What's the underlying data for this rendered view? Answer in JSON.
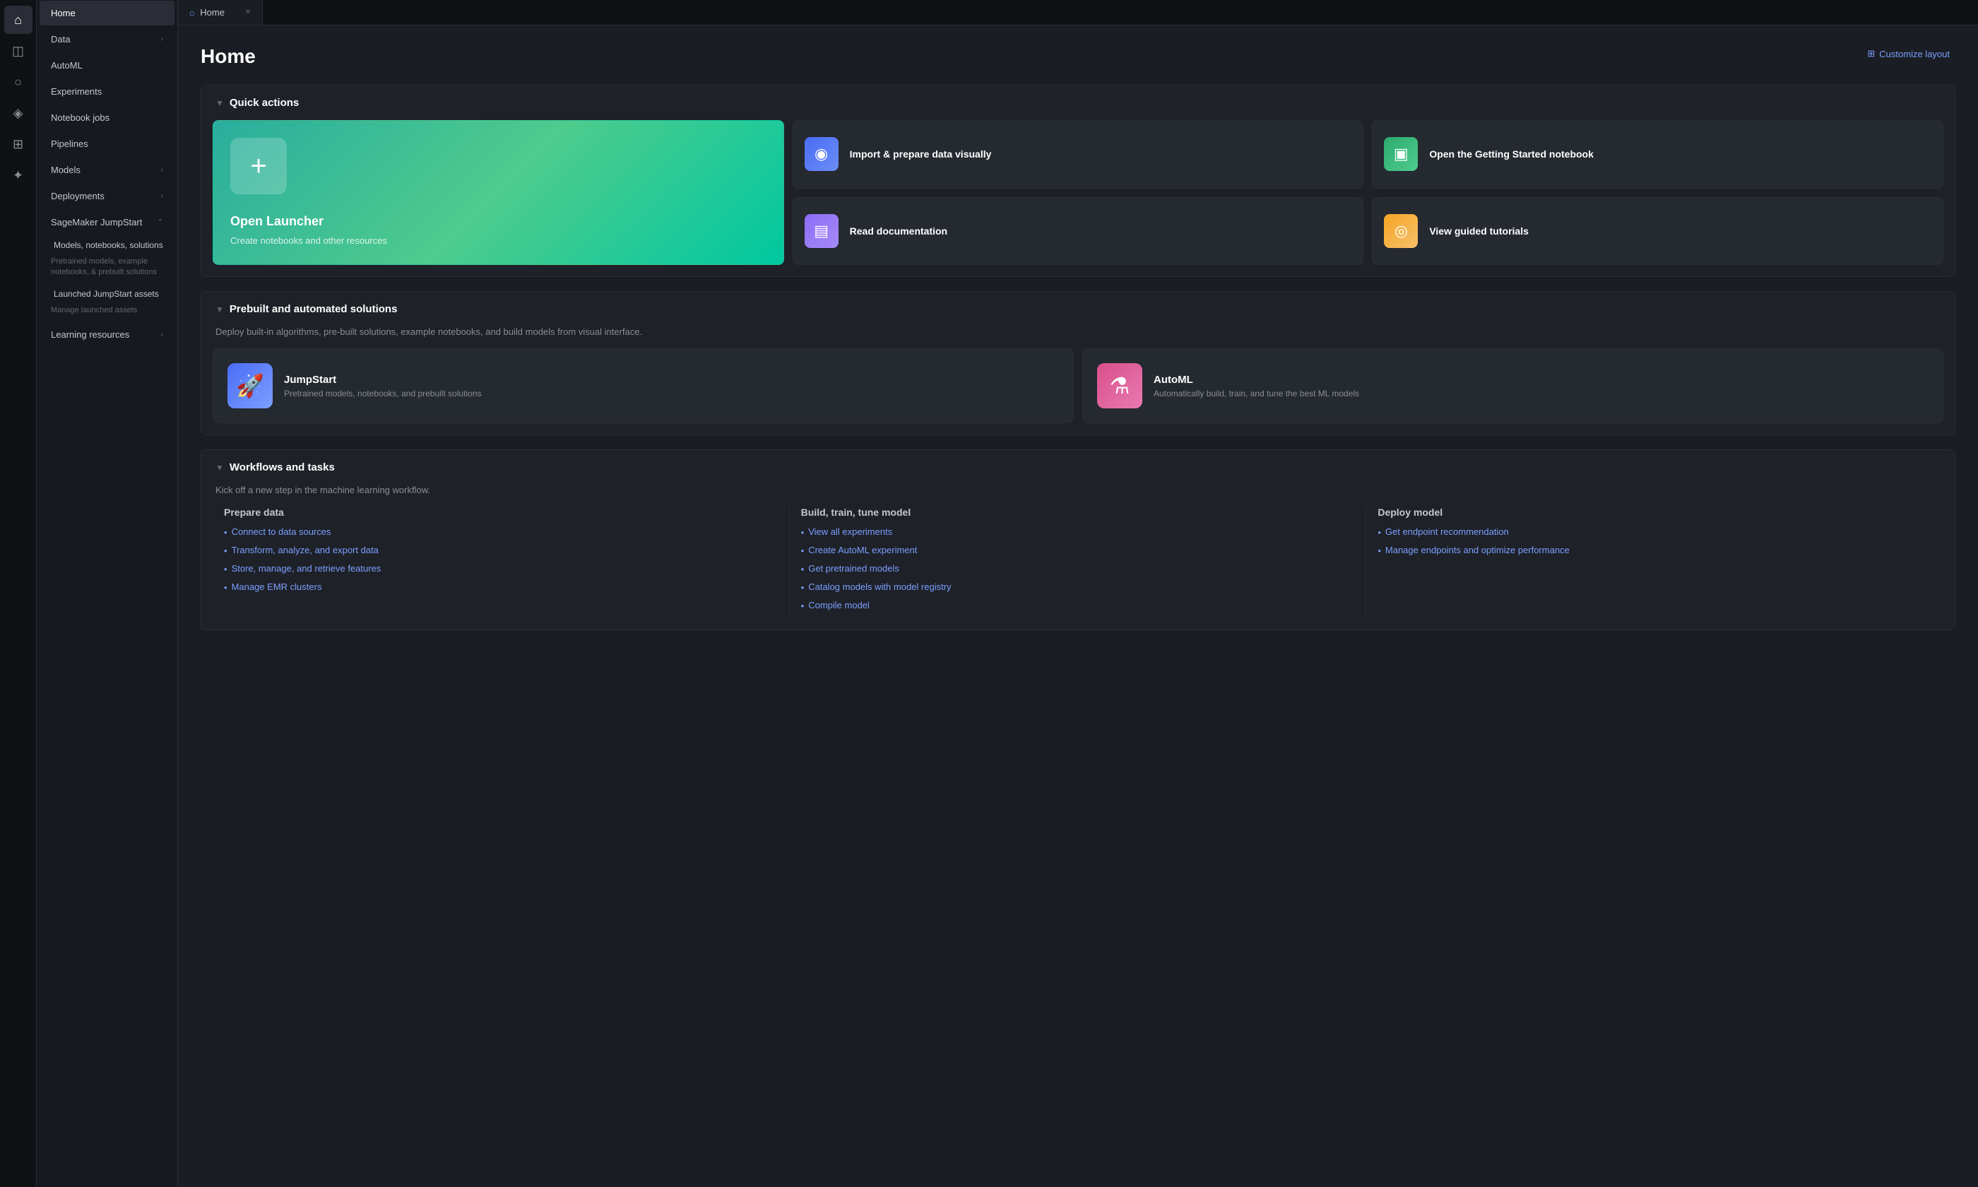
{
  "iconSidebar": {
    "items": [
      {
        "id": "home",
        "icon": "⌂",
        "active": true
      },
      {
        "id": "data",
        "icon": "◫"
      },
      {
        "id": "automl",
        "icon": "○"
      },
      {
        "id": "experiments",
        "icon": "◈"
      },
      {
        "id": "pipelines",
        "icon": "⊞"
      },
      {
        "id": "plugin",
        "icon": "✦"
      }
    ]
  },
  "navSidebar": {
    "items": [
      {
        "label": "Home",
        "active": true
      },
      {
        "label": "Data",
        "hasChevron": true
      },
      {
        "label": "AutoML"
      },
      {
        "label": "Experiments"
      },
      {
        "label": "Notebook jobs"
      },
      {
        "label": "Pipelines"
      },
      {
        "label": "Models",
        "hasChevron": true
      },
      {
        "label": "Deployments",
        "hasChevron": true
      },
      {
        "label": "SageMaker JumpStart",
        "hasChevron": true,
        "expanded": true,
        "subItems": [
          {
            "label": "Models, notebooks, solutions",
            "description": "Pretrained models, example notebooks, & prebuilt solutions"
          },
          {
            "label": "Launched JumpStart assets",
            "description": "Manage launched assets"
          }
        ]
      },
      {
        "label": "Learning resources",
        "hasChevron": true
      }
    ]
  },
  "tab": {
    "icon": "⌂",
    "label": "Home",
    "closeLabel": "✕"
  },
  "page": {
    "title": "Home",
    "customizeLayoutLabel": "Customize layout",
    "customizeLayoutIcon": "⊞"
  },
  "quickActions": {
    "sectionTitle": "Quick actions",
    "chevron": "▼",
    "openLauncher": {
      "label": "Open Launcher",
      "description": "Create notebooks and other resources",
      "icon": "+"
    },
    "cards": [
      {
        "label": "Import & prepare data visually",
        "icon": "◉",
        "color": "blue"
      },
      {
        "label": "Open the Getting Started notebook",
        "icon": "▣",
        "color": "green"
      },
      {
        "label": "Read documentation",
        "icon": "▤",
        "color": "purple"
      },
      {
        "label": "View guided tutorials",
        "icon": "◎",
        "color": "orange"
      }
    ]
  },
  "prebuilt": {
    "sectionTitle": "Prebuilt and automated solutions",
    "chevron": "▼",
    "description": "Deploy built-in algorithms, pre-built solutions, example notebooks, and build models from visual interface.",
    "cards": [
      {
        "label": "JumpStart",
        "description": "Pretrained models, notebooks, and prebuilt solutions",
        "icon": "🚀",
        "color": "indigo"
      },
      {
        "label": "AutoML",
        "description": "Automatically build, train, and tune the best ML models",
        "icon": "⚗",
        "color": "pink"
      }
    ]
  },
  "workflows": {
    "sectionTitle": "Workflows and tasks",
    "chevron": "▼",
    "description": "Kick off a new step in the machine learning workflow.",
    "columns": [
      {
        "title": "Prepare data",
        "links": [
          "Connect to data sources",
          "Transform, analyze, and export data",
          "Store, manage, and retrieve features",
          "Manage EMR clusters"
        ]
      },
      {
        "title": "Build, train, tune model",
        "links": [
          "View all experiments",
          "Create AutoML experiment",
          "Get pretrained models",
          "Catalog models with model registry",
          "Compile model"
        ]
      },
      {
        "title": "Deploy model",
        "links": [
          "Get endpoint recommendation",
          "Manage endpoints and optimize performance"
        ]
      }
    ]
  }
}
